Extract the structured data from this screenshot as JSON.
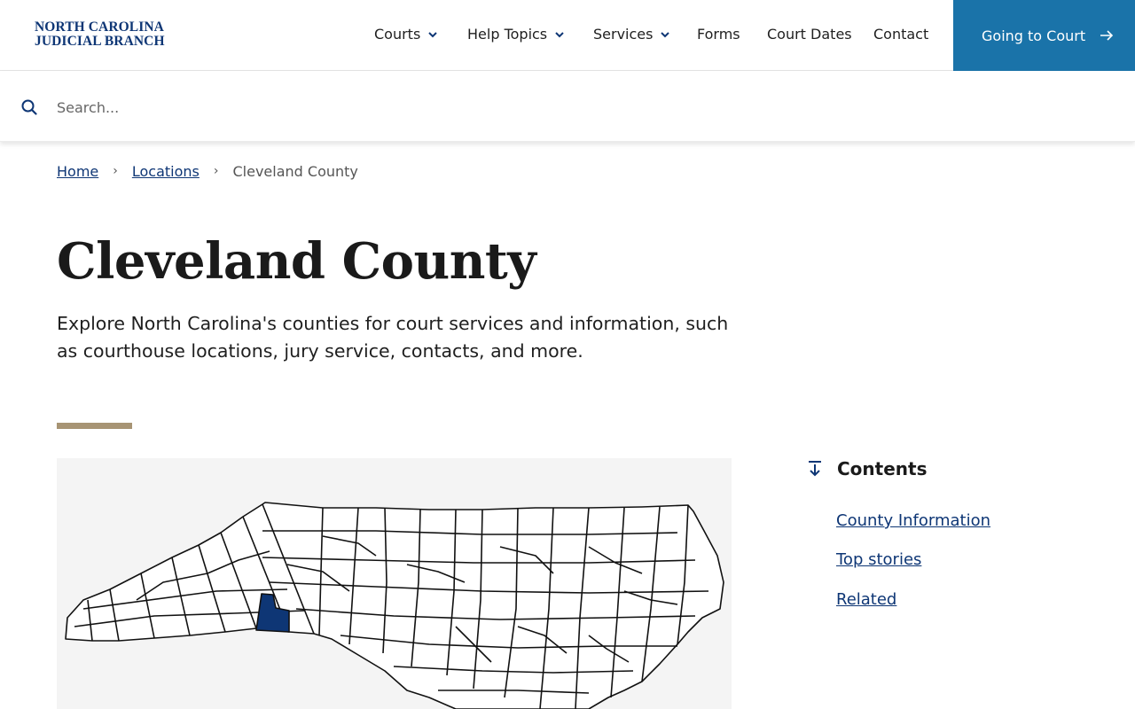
{
  "header": {
    "logo_line1": "NORTH CAROLINA",
    "logo_line2": "JUDICIAL BRANCH",
    "nav": [
      {
        "label": "Courts",
        "has_dropdown": true
      },
      {
        "label": "Help Topics",
        "has_dropdown": true
      },
      {
        "label": "Services",
        "has_dropdown": true
      },
      {
        "label": "Forms",
        "has_dropdown": false
      },
      {
        "label": "Court Dates",
        "has_dropdown": false
      },
      {
        "label": "Contact",
        "has_dropdown": false
      }
    ],
    "cta_label": "Going to Court"
  },
  "search": {
    "placeholder": "Search...",
    "value": ""
  },
  "breadcrumb": {
    "home": "Home",
    "locations": "Locations",
    "current": "Cleveland County",
    "separator": "›"
  },
  "page": {
    "title": "Cleveland County",
    "intro": "Explore North Carolina's counties for court services and information, such as courthouse locations, jury service, contacts, and more."
  },
  "map": {
    "highlighted_county": "Cleveland County",
    "highlight_color": "#0e3675"
  },
  "contents": {
    "heading": "Contents",
    "links": [
      "County Information",
      "Top stories",
      "Related"
    ]
  },
  "colors": {
    "brand_navy": "#0e3675",
    "cta_blue": "#1a73a9",
    "accent_tan": "#a79474"
  }
}
